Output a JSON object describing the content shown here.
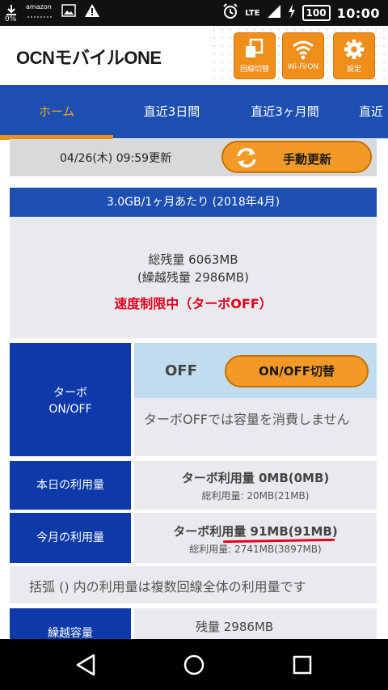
{
  "status_bar": {
    "left_items": [
      "0%",
      "amazon",
      "image-icon",
      "warning-icon"
    ],
    "percent": "0%",
    "amazon_label": "amazon",
    "network": "LTE",
    "battery": "100",
    "time": "10:00"
  },
  "header": {
    "logo": "OCNモバイルONE",
    "buttons": [
      {
        "label": "回線切替",
        "icon": "sim-switch-icon"
      },
      {
        "label": "Wi-Fi/ON",
        "icon": "wifi-icon"
      },
      {
        "label": "設定",
        "icon": "gear-icon"
      }
    ]
  },
  "tabs": [
    {
      "label": "ホーム",
      "active": true
    },
    {
      "label": "直近3日間",
      "active": false
    },
    {
      "label": "直近3ヶ月間",
      "active": false
    },
    {
      "label": "直近",
      "active": false
    }
  ],
  "update": {
    "timestamp": "04/26(木) 09:59更新",
    "button_label": "手動更新"
  },
  "plan": {
    "title": "3.0GB/1ヶ月あたり (2018年4月)",
    "total_remaining": "総残量 6063MB",
    "carryover_remaining": "(繰越残量 2986MB)",
    "alert": "速度制限中（ターボOFF）"
  },
  "turbo": {
    "label_line1": "ターボ",
    "label_line2": "ON/OFF",
    "state": "OFF",
    "toggle_label": "ON/OFF切替",
    "description": "ターボOFFでは容量を消費しません"
  },
  "today": {
    "label": "本日の利用量",
    "turbo_usage": "ターボ利用量 0MB(0MB)",
    "total_usage": "総利用量: 20MB(21MB)"
  },
  "month": {
    "label": "今月の利用量",
    "turbo_usage": "ターボ利用量 91MB(91MB)",
    "total_usage": "総利用量: 2741MB(3897MB)"
  },
  "note": "括弧 () 内の利用量は複数回線全体の利用量です",
  "carryover": {
    "label": "繰越容量",
    "remaining": "残量 2986MB"
  },
  "colors": {
    "brand_blue": "#1d4fb0",
    "accent_orange": "#f08e1c",
    "alert_red": "#e3001c"
  }
}
